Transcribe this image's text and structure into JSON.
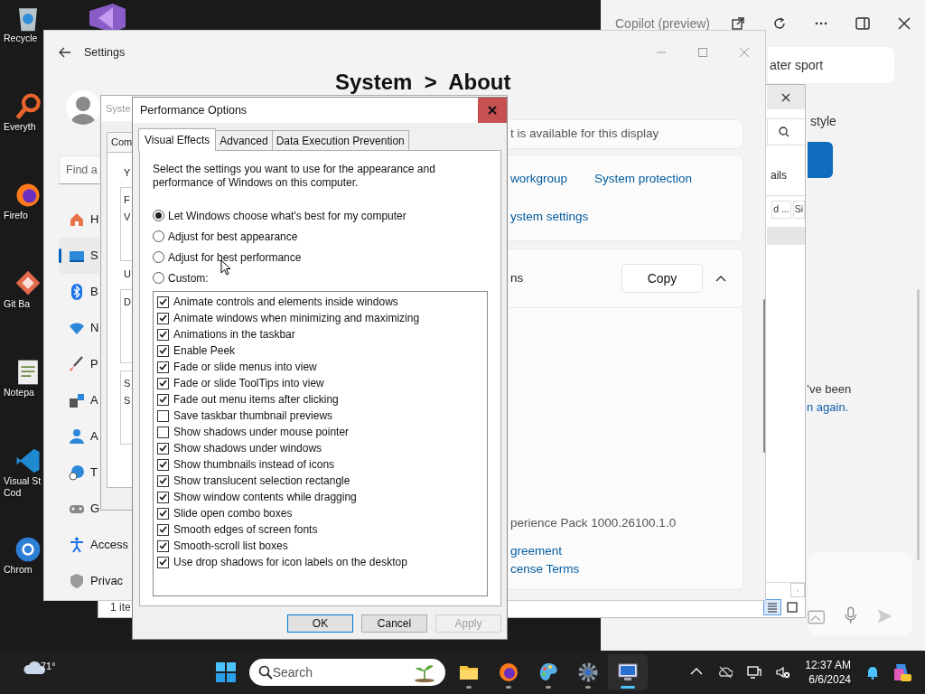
{
  "desktop_icons": [
    {
      "kind": "vs"
    },
    {
      "kind": "recycle",
      "lines": [
        "Recycle"
      ]
    },
    {
      "kind": "search",
      "lines": [
        "Everyth"
      ]
    },
    {
      "kind": "firefox",
      "lines": [
        "Firefo"
      ]
    },
    {
      "kind": "git",
      "lines": [
        "Git Ba"
      ]
    },
    {
      "kind": "notepad",
      "lines": [
        "Notepa"
      ]
    },
    {
      "kind": "vscode",
      "lines": [
        "Visual St",
        "Cod"
      ]
    },
    {
      "kind": "chrome",
      "lines": [
        "Chrom"
      ]
    }
  ],
  "copilot": {
    "title": "Copilot (preview)",
    "prompt": "ater sport",
    "style_text": "style",
    "message": "’ve been",
    "link": "n again."
  },
  "explorer": {
    "details": "ails",
    "columns": [
      "d ...",
      "Si"
    ],
    "status": "1 ite",
    "views": [
      {
        "kind": "details",
        "selected": true
      },
      {
        "kind": "tiles",
        "selected": false
      }
    ]
  },
  "settings": {
    "title": "Settings",
    "search_placeholder": "Find a",
    "nav": [
      {
        "kind": "home",
        "label": "H",
        "selected": false
      },
      {
        "kind": "system",
        "label": "S",
        "selected": true
      },
      {
        "kind": "bluetooth",
        "label": "B",
        "selected": false
      },
      {
        "kind": "network",
        "label": "N",
        "selected": false
      },
      {
        "kind": "brush",
        "label": "P",
        "selected": false
      },
      {
        "kind": "apps",
        "label": "A",
        "selected": false
      },
      {
        "kind": "accounts",
        "label": "A",
        "selected": false
      },
      {
        "kind": "time",
        "label": "T",
        "selected": false
      },
      {
        "kind": "gaming",
        "label": "G",
        "selected": false
      },
      {
        "kind": "accessibility",
        "label": "Access",
        "selected": false
      },
      {
        "kind": "privacy",
        "label": "Privac",
        "selected": false
      }
    ],
    "heading": "System  >  About",
    "display_note": "t is available for this display",
    "links": [
      "workgroup",
      "System protection"
    ],
    "link_row2": "ystem settings",
    "spec_label": "ns",
    "copy_button": "Copy",
    "expanded": true,
    "version_text": "perience Pack 1000.26100.1.0",
    "bottom_links": [
      "greement",
      "cense Terms"
    ]
  },
  "system_properties": {
    "title": "Syste",
    "tab": "Com",
    "intro": "Y",
    "groups": [
      {
        "lines": [
          "F",
          "V"
        ]
      },
      {
        "caption": "U",
        "lines": [
          "D"
        ]
      },
      {
        "lines": [
          "S",
          "S"
        ]
      }
    ]
  },
  "performance_options": {
    "title": "Performance Options",
    "tabs": [
      {
        "label": "Visual Effects",
        "selected": true
      },
      {
        "label": "Advanced",
        "selected": false
      },
      {
        "label": "Data Execution Prevention",
        "selected": false
      }
    ],
    "intro": "Select the settings you want to use for the appearance and performance of Windows on this computer.",
    "options": [
      {
        "label": "Let Windows choose what's best for my computer",
        "selected": true
      },
      {
        "label": "Adjust for best appearance",
        "selected": false
      },
      {
        "label": "Adjust for best performance",
        "selected": false
      },
      {
        "label": "Custom:",
        "selected": false
      }
    ],
    "effects": [
      {
        "label": "Animate controls and elements inside windows",
        "checked": true
      },
      {
        "label": "Animate windows when minimizing and maximizing",
        "checked": true
      },
      {
        "label": "Animations in the taskbar",
        "checked": true
      },
      {
        "label": "Enable Peek",
        "checked": true
      },
      {
        "label": "Fade or slide menus into view",
        "checked": true
      },
      {
        "label": "Fade or slide ToolTips into view",
        "checked": true
      },
      {
        "label": "Fade out menu items after clicking",
        "checked": true
      },
      {
        "label": "Save taskbar thumbnail previews",
        "checked": false
      },
      {
        "label": "Show shadows under mouse pointer",
        "checked": false
      },
      {
        "label": "Show shadows under windows",
        "checked": true
      },
      {
        "label": "Show thumbnails instead of icons",
        "checked": true
      },
      {
        "label": "Show translucent selection rectangle",
        "checked": true
      },
      {
        "label": "Show window contents while dragging",
        "checked": true
      },
      {
        "label": "Slide open combo boxes",
        "checked": true
      },
      {
        "label": "Smooth edges of screen fonts",
        "checked": true
      },
      {
        "label": "Smooth-scroll list boxes",
        "checked": true
      },
      {
        "label": "Use drop shadows for icon labels on the desktop",
        "checked": true
      }
    ],
    "buttons": [
      {
        "label": "OK",
        "default": true,
        "disabled": false
      },
      {
        "label": "Cancel",
        "default": false,
        "disabled": false
      },
      {
        "label": "Apply",
        "default": false,
        "disabled": true
      }
    ]
  },
  "taskbar": {
    "weather": "71°",
    "search_placeholder": "Search",
    "apps": [
      {
        "kind": "folder",
        "active": false
      },
      {
        "kind": "firefox",
        "active": false
      },
      {
        "kind": "paint",
        "active": false
      },
      {
        "kind": "gear",
        "active": false
      },
      {
        "kind": "remote",
        "active": true
      }
    ],
    "time": "12:37 AM",
    "date": "6/6/2024"
  }
}
